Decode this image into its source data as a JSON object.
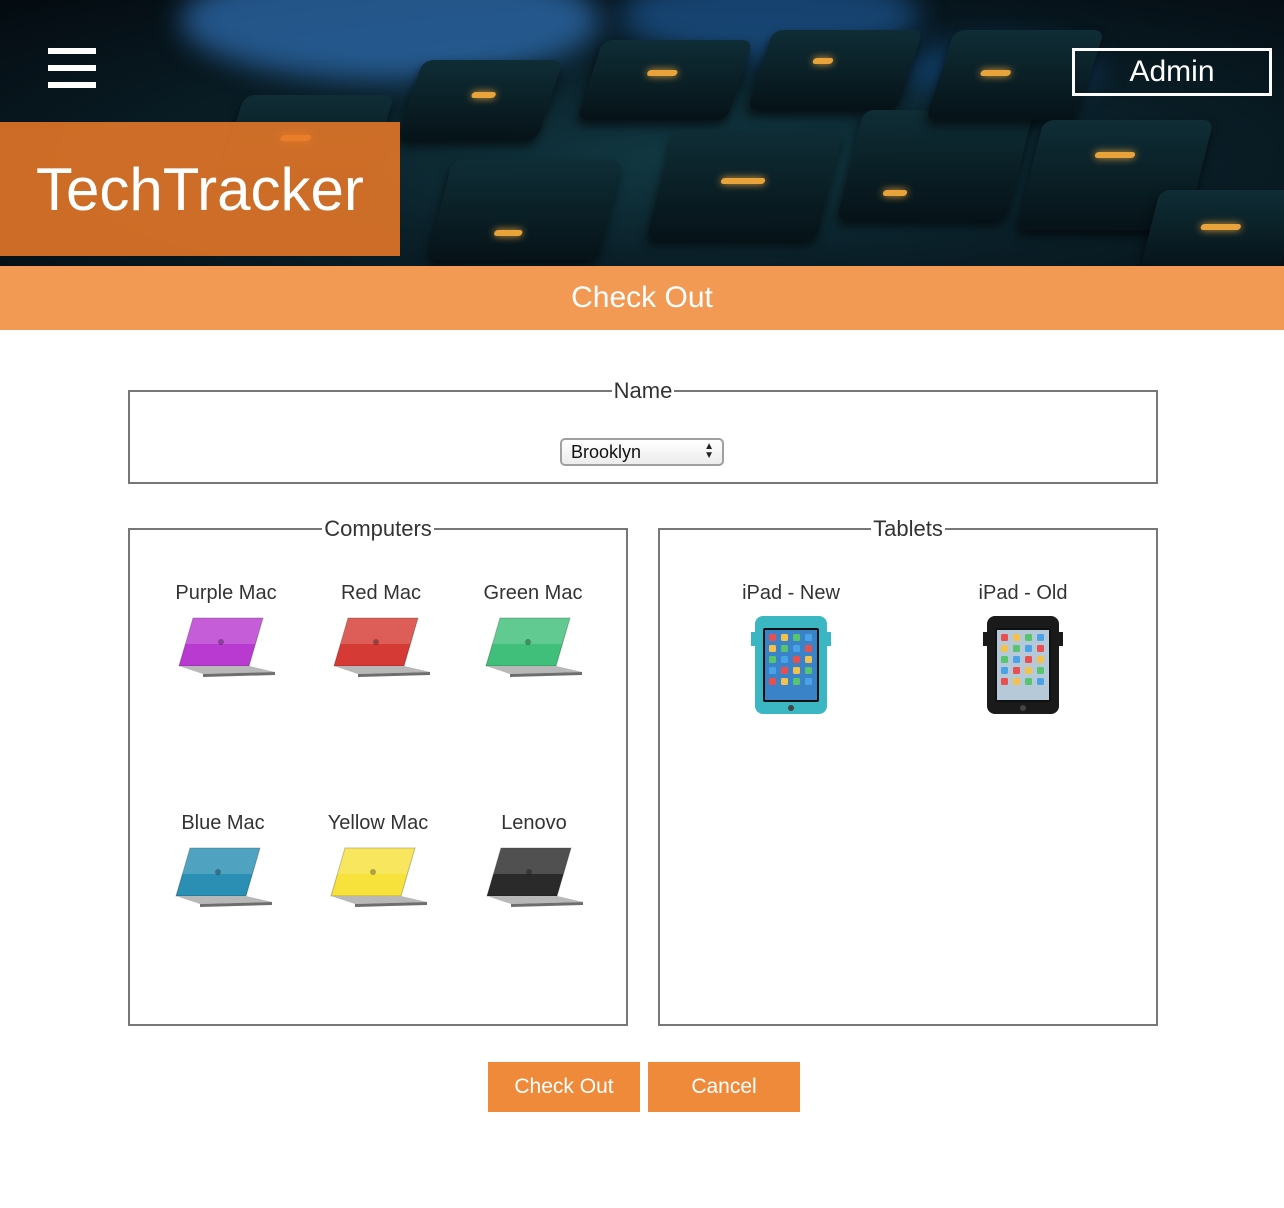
{
  "header": {
    "menu_icon": "hamburger-menu-icon",
    "admin_label": "Admin",
    "brand": "TechTracker"
  },
  "page_title": "Check Out",
  "name_section": {
    "legend": "Name",
    "selected": "Brooklyn"
  },
  "computers": {
    "legend": "Computers",
    "items": [
      {
        "label": "Purple Mac",
        "color": "#b93ad1"
      },
      {
        "label": "Red Mac",
        "color": "#d63a35"
      },
      {
        "label": "Green Mac",
        "color": "#3fbf79"
      },
      {
        "label": "Blue Mac",
        "color": "#2a8fb3"
      },
      {
        "label": "Yellow Mac",
        "color": "#f7e23b"
      },
      {
        "label": "Lenovo",
        "color": "#2a2a2a"
      }
    ]
  },
  "tablets": {
    "legend": "Tablets",
    "items": [
      {
        "label": "iPad - New",
        "color": "#3bb7c4"
      },
      {
        "label": "iPad - Old",
        "color": "#1a1a1a"
      }
    ]
  },
  "actions": {
    "checkout_label": "Check Out",
    "cancel_label": "Cancel"
  },
  "colors": {
    "brand_orange": "#e87928",
    "title_bar": "#f29a54",
    "button_orange": "#ef8a3a"
  }
}
